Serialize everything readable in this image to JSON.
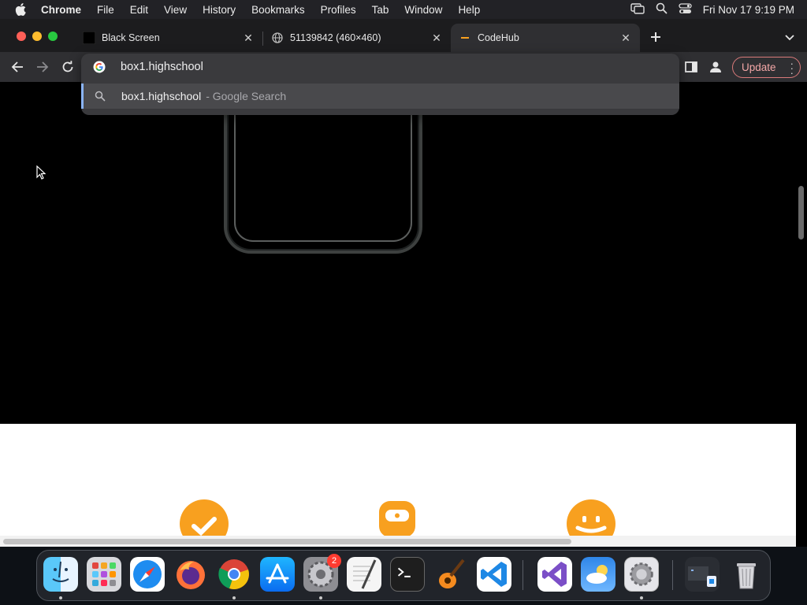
{
  "menubar": {
    "app_name": "Chrome",
    "items": [
      "File",
      "Edit",
      "View",
      "History",
      "Bookmarks",
      "Profiles",
      "Tab",
      "Window",
      "Help"
    ],
    "clock": "Fri Nov 17  9:19 PM"
  },
  "tabs": [
    {
      "title": "Black Screen",
      "favicon": "black-square-icon",
      "active": false
    },
    {
      "title": "51139842 (460×460)",
      "favicon": "globe-icon",
      "active": false
    },
    {
      "title": "CodeHub",
      "favicon": "codehub-icon",
      "active": true
    }
  ],
  "omnibox": {
    "value": "box1.highschool",
    "suggestion_query": "box1.highschool",
    "suggestion_hint": "- Google Search"
  },
  "toolbar": {
    "update_label": "Update"
  },
  "dock": {
    "apps": [
      "Finder",
      "Launchpad",
      "Safari",
      "Firefox",
      "Google Chrome",
      "App Store",
      "System Preferences",
      "TextEdit",
      "Terminal",
      "GarageBand",
      "Visual Studio Code",
      "Visual Studio",
      "Weather",
      "System Settings",
      "Downloads",
      "Trash"
    ],
    "badge": "2"
  },
  "colors": {
    "accent_orange": "#f8a01f",
    "update_red": "#d97a7a",
    "omnibox_focus": "#8ab4f8"
  }
}
